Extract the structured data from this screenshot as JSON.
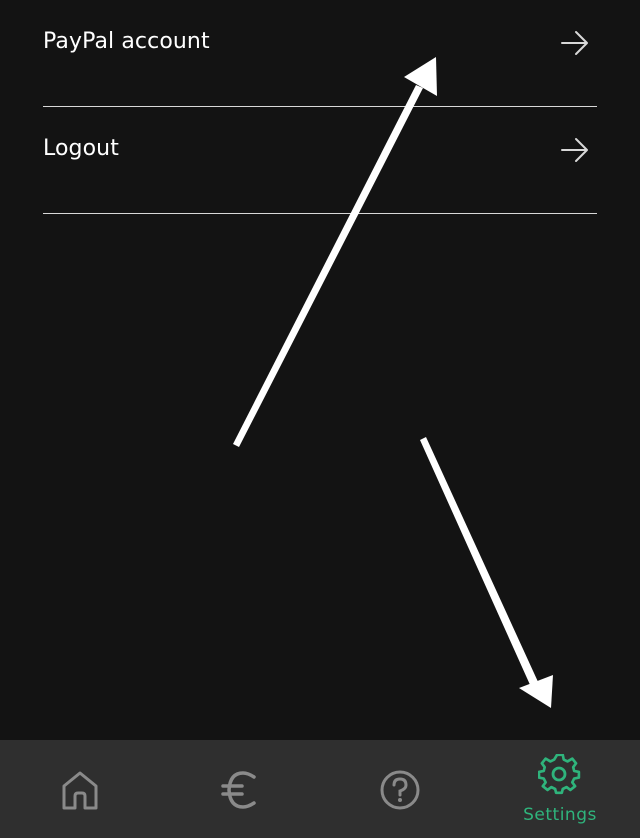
{
  "menu": {
    "items": [
      {
        "label": "PayPal account",
        "icon": "arrow-right-icon"
      },
      {
        "label": "Logout",
        "icon": "arrow-right-icon"
      }
    ]
  },
  "bottom_nav": {
    "items": [
      {
        "icon": "home-icon",
        "label": "",
        "active": false
      },
      {
        "icon": "euro-icon",
        "label": "",
        "active": false
      },
      {
        "icon": "help-icon",
        "label": "",
        "active": false
      },
      {
        "icon": "gear-icon",
        "label": "Settings",
        "active": true
      }
    ]
  },
  "colors": {
    "background": "#131313",
    "nav_background": "#2f2f2f",
    "text": "#ffffff",
    "divider": "#d8d8d8",
    "icon_inactive": "#8a8a8a",
    "accent": "#2fb47c",
    "annotation_arrow": "#ffffff"
  }
}
